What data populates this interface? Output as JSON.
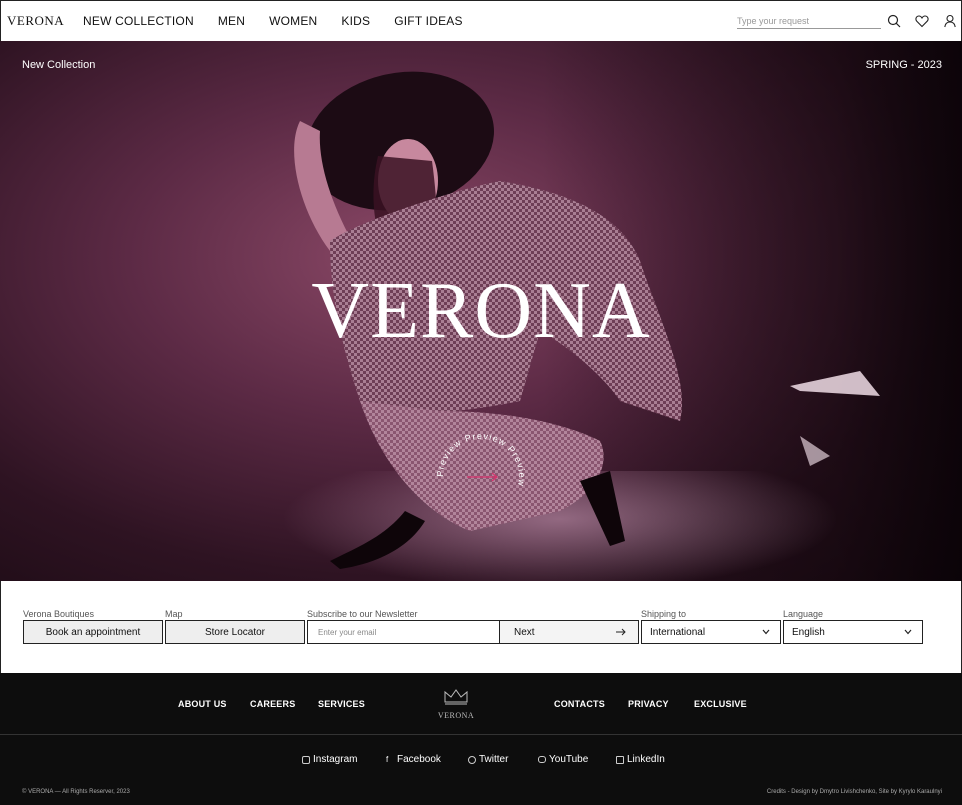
{
  "header": {
    "logo": "VERONA",
    "nav": [
      "NEW COLLECTION",
      "MEN",
      "WOMEN",
      "KIDS",
      "GIFT IDEAS"
    ],
    "search_placeholder": "Type your request",
    "icons": [
      "search-icon",
      "heart-icon",
      "user-icon"
    ]
  },
  "hero": {
    "top_left": "New Collection",
    "top_right": "SPRING - 2023",
    "title": "VERONA",
    "preview_text": "Preview Preview Preview ",
    "accent": "#d6336c"
  },
  "bar": {
    "boutiques_label": "Verona Boutiques",
    "appointment_button": "Book an appointment",
    "map_label": "Map",
    "store_locator_button": "Store Locator",
    "newsletter_label": "Subscribe to our Newsletter",
    "email_placeholder": "Enter your email",
    "next_button": "Next",
    "shipping_label": "Shipping to",
    "shipping_value": "International",
    "language_label": "Language",
    "language_value": "English"
  },
  "footer": {
    "links_left": [
      "ABOUT US",
      "CAREERS",
      "SERVICES"
    ],
    "logo_text": "VERONA",
    "links_right": [
      "CONTACTS",
      "PRIVACY",
      "EXCLUSIVE"
    ],
    "social": [
      "Instagram",
      "Facebook",
      "Twitter",
      "YouTube",
      "LinkedIn"
    ],
    "copyright": "© VERONA — All Rights Reserver, 2023",
    "credits": "Credits - Design by Dmytro Livishchenko, Site by Kyrylo Karaulnyi"
  }
}
